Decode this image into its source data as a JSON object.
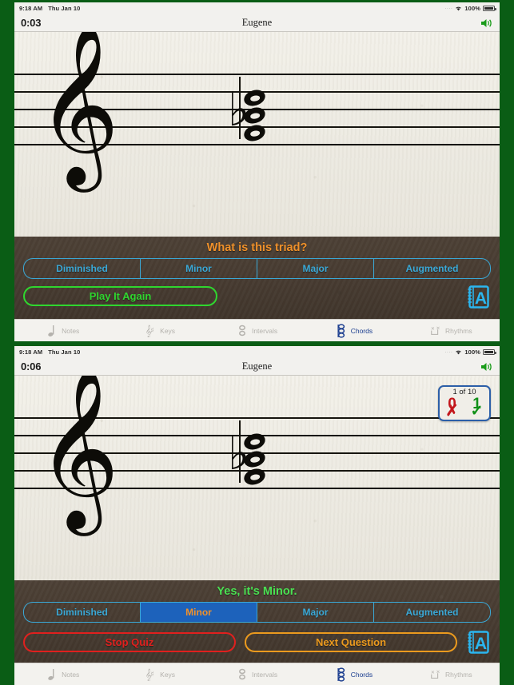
{
  "theme": {
    "frame_color": "#0a5d15",
    "panel_brown": "#473b31",
    "prompt_orange": "#f0912a",
    "prompt_green": "#4ae052",
    "segment_blue": "#3aa8d6",
    "selected_fill": "#1d62bb",
    "play_green": "#2fd62f",
    "stop_red": "#e0201e",
    "next_orange": "#eb9a1e",
    "glossary_cyan": "#2bb6ef"
  },
  "screens": [
    {
      "status_bar": {
        "time": "9:18 AM",
        "date": "Thu Jan 10",
        "battery_percent": "100%",
        "wifi_icon": "wifi-icon",
        "battery_icon": "battery-icon",
        "signal_icon": "signal-dots-icon"
      },
      "nav_bar": {
        "timer": "0:03",
        "title": "Eugene",
        "speaker_icon": "speaker-icon"
      },
      "score_area": {
        "clef": "treble-clef",
        "accidental": "flat-sign",
        "chord": "stacked-triad-whole-notes",
        "badge_visible": false
      },
      "panel": {
        "prompt": "What is this triad?",
        "prompt_style": "question",
        "options": [
          {
            "label": "Diminished",
            "selected": false
          },
          {
            "label": "Minor",
            "selected": false
          },
          {
            "label": "Major",
            "selected": false
          },
          {
            "label": "Augmented",
            "selected": false
          }
        ],
        "buttons": [
          {
            "label": "Play It Again",
            "style": "play"
          }
        ],
        "glossary_icon": "glossary-notebook-a-icon"
      },
      "tabs": [
        {
          "label": "Notes",
          "icon": "quarter-note-icon",
          "active": false
        },
        {
          "label": "Keys",
          "icon": "key-signature-icon",
          "active": false
        },
        {
          "label": "Intervals",
          "icon": "interval-notes-icon",
          "active": false
        },
        {
          "label": "Chords",
          "icon": "chord-stack-icon",
          "active": true
        },
        {
          "label": "Rhythms",
          "icon": "rhythm-x-notes-icon",
          "active": false
        }
      ]
    },
    {
      "status_bar": {
        "time": "9:18 AM",
        "date": "Thu Jan 10",
        "battery_percent": "100%",
        "wifi_icon": "wifi-icon",
        "battery_icon": "battery-icon",
        "signal_icon": "signal-dots-icon"
      },
      "nav_bar": {
        "timer": "0:06",
        "title": "Eugene",
        "speaker_icon": "speaker-icon"
      },
      "score_area": {
        "clef": "treble-clef",
        "accidental": "flat-sign",
        "chord": "stacked-triad-whole-notes",
        "badge_visible": true,
        "badge": {
          "progress": "1 of 10",
          "wrong_count": "0",
          "wrong_mark": "✗",
          "correct_count": "1",
          "correct_mark": "✓"
        }
      },
      "panel": {
        "prompt": "Yes, it's Minor.",
        "prompt_style": "correct",
        "options": [
          {
            "label": "Diminished",
            "selected": false
          },
          {
            "label": "Minor",
            "selected": true
          },
          {
            "label": "Major",
            "selected": false
          },
          {
            "label": "Augmented",
            "selected": false
          }
        ],
        "buttons": [
          {
            "label": "Stop Quiz",
            "style": "stop"
          },
          {
            "label": "Next Question",
            "style": "next"
          }
        ],
        "glossary_icon": "glossary-notebook-a-icon"
      },
      "tabs": [
        {
          "label": "Notes",
          "icon": "quarter-note-icon",
          "active": false
        },
        {
          "label": "Keys",
          "icon": "key-signature-icon",
          "active": false
        },
        {
          "label": "Intervals",
          "icon": "interval-notes-icon",
          "active": false
        },
        {
          "label": "Chords",
          "icon": "chord-stack-icon",
          "active": true
        },
        {
          "label": "Rhythms",
          "icon": "rhythm-x-notes-icon",
          "active": false
        }
      ]
    }
  ]
}
